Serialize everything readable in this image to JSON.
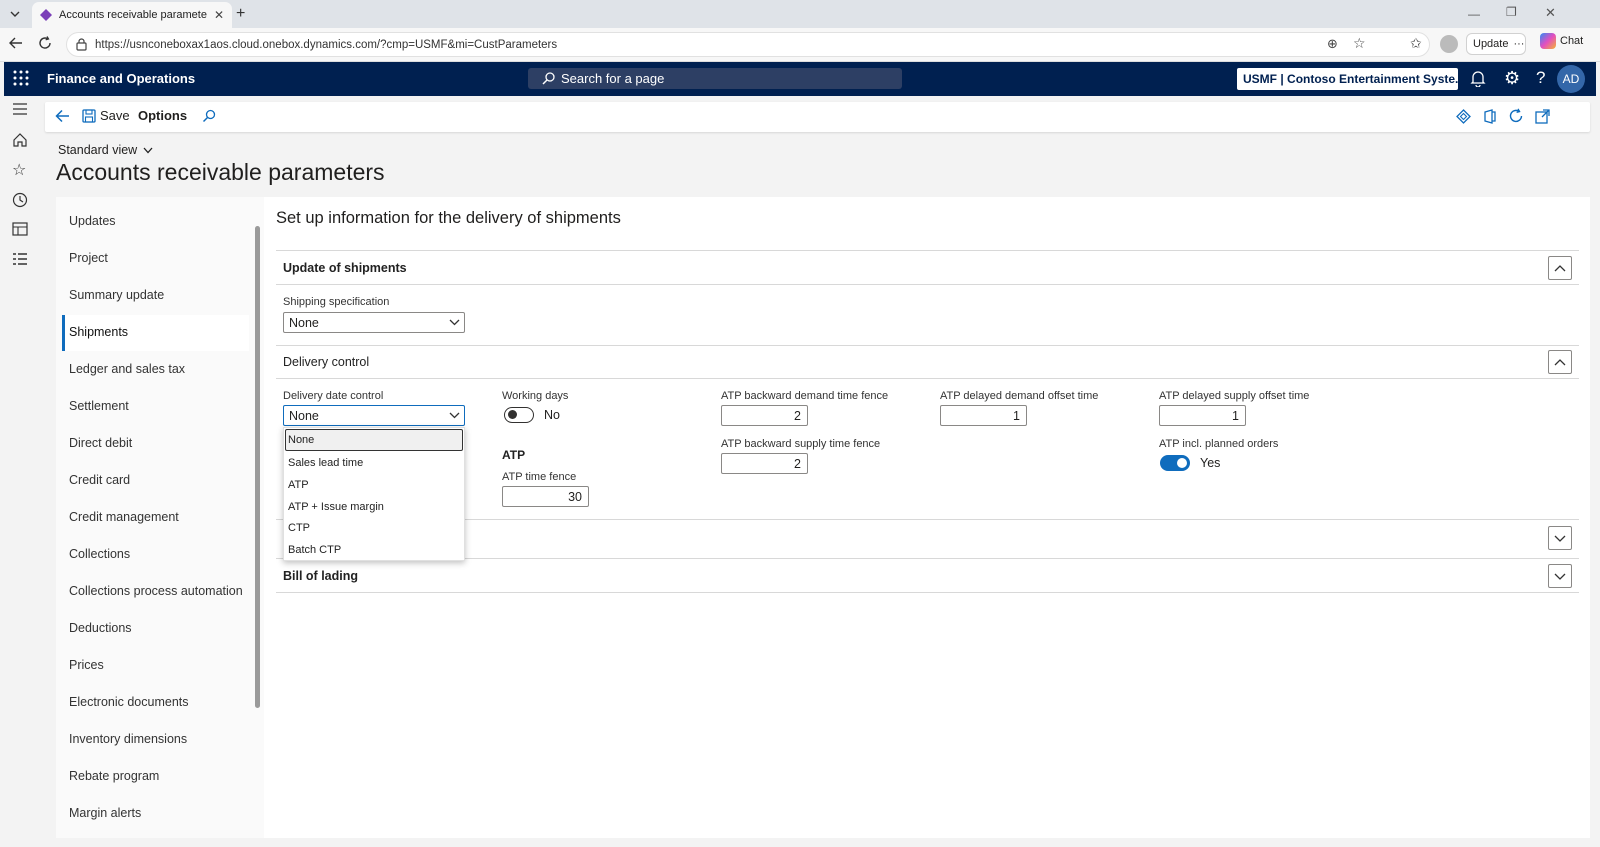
{
  "browser": {
    "tab_title": "Accounts receivable parameters -",
    "url": "https://usnconeboxax1aos.cloud.onebox.dynamics.com/?cmp=USMF&mi=CustParameters",
    "update_label": "Update",
    "chat_label": "Chat"
  },
  "navbar": {
    "app_title": "Finance and Operations",
    "search_placeholder": "Search for a page",
    "company": "USMF | Contoso Entertainment Syste...",
    "avatar_initials": "AD"
  },
  "actionpane": {
    "save_label": "Save",
    "options_label": "Options"
  },
  "page": {
    "view_label": "Standard view",
    "title": "Accounts receivable parameters"
  },
  "leftnav": {
    "items": [
      "Updates",
      "Project",
      "Summary update",
      "Shipments",
      "Ledger and sales tax",
      "Settlement",
      "Direct debit",
      "Credit card",
      "Credit management",
      "Collections",
      "Collections process automation",
      "Deductions",
      "Prices",
      "Electronic documents",
      "Inventory dimensions",
      "Rebate program",
      "Margin alerts"
    ],
    "selected": "Shipments"
  },
  "content": {
    "heading": "Set up information for the delivery of shipments",
    "update_of_shipments": {
      "title": "Update of shipments",
      "shipping_spec_label": "Shipping specification",
      "shipping_spec_value": "None"
    },
    "delivery_control": {
      "title": "Delivery control",
      "delivery_date_control_label": "Delivery date control",
      "delivery_date_control_value": "None",
      "working_days_label": "Working days",
      "working_days_value": "No",
      "atp_heading": "ATP",
      "atp_time_fence_label": "ATP time fence",
      "atp_time_fence_value": "30",
      "atp_backward_demand_label": "ATP backward demand time fence",
      "atp_backward_demand_value": "2",
      "atp_backward_supply_label": "ATP backward supply time fence",
      "atp_backward_supply_value": "2",
      "atp_delayed_demand_label": "ATP delayed demand offset time",
      "atp_delayed_demand_value": "1",
      "atp_delayed_supply_label": "ATP delayed supply offset time",
      "atp_delayed_supply_value": "1",
      "atp_planned_orders_label": "ATP incl. planned orders",
      "atp_planned_orders_value": "Yes"
    },
    "bill_of_lading": {
      "title": "Bill of lading"
    },
    "dropdown_options": [
      "None",
      "Sales lead time",
      "ATP",
      "ATP + Issue margin",
      "CTP",
      "Batch CTP"
    ]
  },
  "colors": {
    "navbar_bg": "#002050",
    "accent": "#0f6cbd"
  }
}
